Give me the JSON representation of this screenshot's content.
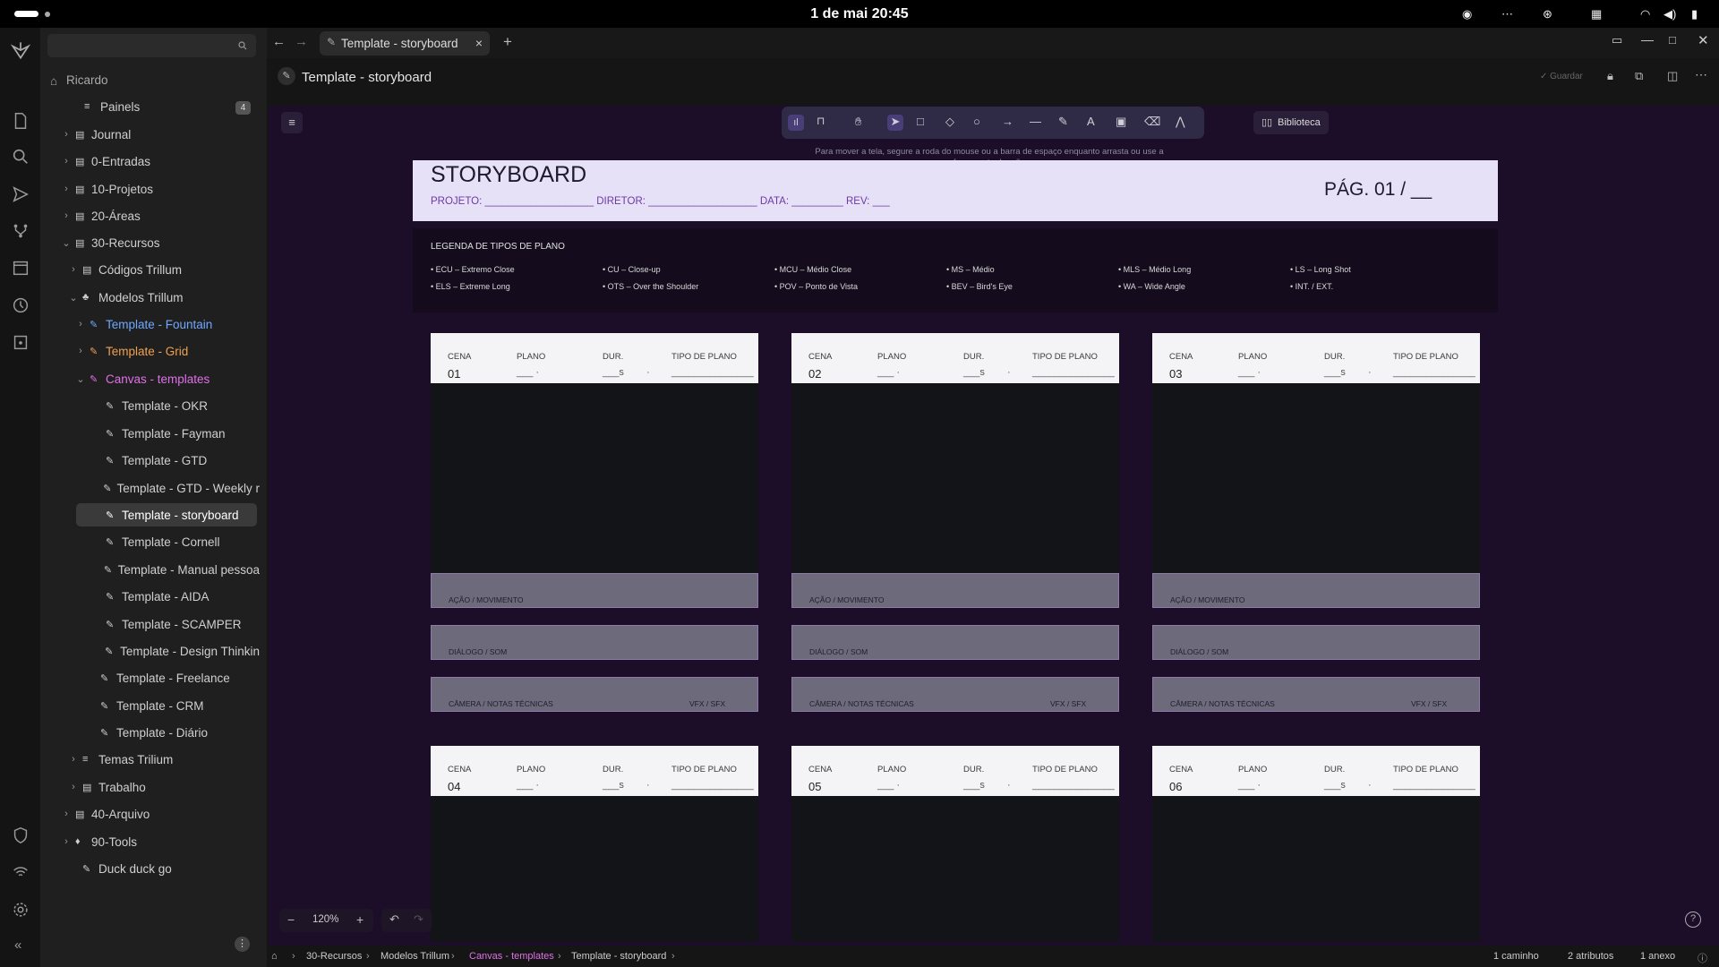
{
  "system": {
    "clock": "1 de mai  20:45"
  },
  "sidebar": {
    "user": "Ricardo",
    "badge": "4",
    "items": [
      {
        "label": "Painels",
        "color": "#cfcfcf"
      },
      {
        "label": "Journal",
        "color": "#cfcfcf"
      },
      {
        "label": "0-Entradas",
        "color": "#cfcfcf"
      },
      {
        "label": "10-Projetos",
        "color": "#cfcfcf"
      },
      {
        "label": "20-Áreas",
        "color": "#cfcfcf"
      },
      {
        "label": "30-Recursos",
        "color": "#cfcfcf"
      },
      {
        "label": "Códigos Trillum",
        "color": "#cfcfcf"
      },
      {
        "label": "Modelos Trillum",
        "color": "#cfcfcf"
      },
      {
        "label": "Template - Fountain",
        "color": "#6ea8ff"
      },
      {
        "label": "Template - Grid",
        "color": "#f0a050"
      },
      {
        "label": "Canvas - templates",
        "color": "#e070e8"
      },
      {
        "label": "Template - OKR",
        "color": "#cfcfcf"
      },
      {
        "label": "Template - Fayman",
        "color": "#cfcfcf"
      },
      {
        "label": "Template - GTD",
        "color": "#cfcfcf"
      },
      {
        "label": "Template - GTD - Weekly r",
        "color": "#cfcfcf"
      },
      {
        "label": "Template - storyboard",
        "color": "#ffffff"
      },
      {
        "label": "Template - Cornell",
        "color": "#cfcfcf"
      },
      {
        "label": "Template - Manual pessoa",
        "color": "#cfcfcf"
      },
      {
        "label": "Template - AIDA",
        "color": "#cfcfcf"
      },
      {
        "label": "Template - SCAMPER",
        "color": "#cfcfcf"
      },
      {
        "label": "Template - Design Thinkin",
        "color": "#cfcfcf"
      },
      {
        "label": "Template - Freelance",
        "color": "#cfcfcf"
      },
      {
        "label": "Template - CRM",
        "color": "#cfcfcf"
      },
      {
        "label": "Template - Diário",
        "color": "#cfcfcf"
      },
      {
        "label": "Temas Trilium",
        "color": "#cfcfcf"
      },
      {
        "label": "Trabalho",
        "color": "#cfcfcf"
      },
      {
        "label": "40-Arquivo",
        "color": "#cfcfcf"
      },
      {
        "label": "90-Tools",
        "color": "#cfcfcf"
      },
      {
        "label": "Duck duck go",
        "color": "#cfcfcf"
      }
    ]
  },
  "tab": {
    "title": "Template - storyboard",
    "close": "×",
    "new": "+"
  },
  "note": {
    "title": "Template - storyboard",
    "save": "✓ Guardar"
  },
  "canvas": {
    "library": "Biblioteca",
    "hint": "Para mover a tela, segure a roda do mouse ou a barra de espaço enquanto arrasta ou use a ferramenta de mão",
    "zoom": "120%"
  },
  "storyboard": {
    "title": "STORYBOARD",
    "project_row": "PROJETO: ___________________   DIRETOR: ___________________   DATA: _________   REV: ___",
    "page": "PÁG. 01 / __",
    "legend_title": "LEGENDA DE TIPOS DE PLANO",
    "legend": [
      "• ECU – Extremo Close",
      "• CU – Close-up",
      "• MCU – Médio Close",
      "• MS – Médio",
      "• MLS – Médio Long",
      "• LS – Long Shot",
      "• ELS – Extreme Long",
      "• OTS – Over the Shoulder",
      "• POV – Ponto de Vista",
      "• BEV – Bird's Eye",
      "• WA – Wide Angle",
      "• INT. / EXT."
    ],
    "labels": {
      "cena": "CENA",
      "plano": "PLANO",
      "dur": "DUR.",
      "tipo": "TIPO DE PLANO",
      "plano_blank": "___ ·",
      "dur_blank": "___s",
      "dot": "·",
      "tipo_blank": "_______________",
      "acao": "AÇÃO / MOVIMENTO",
      "dialogo": "DIÁLOGO / SOM",
      "camera": "CÂMERA / NOTAS TÉCNICAS",
      "vfx": "VFX / SFX"
    },
    "scenes": [
      "01",
      "02",
      "03",
      "04",
      "05",
      "06"
    ]
  },
  "status": {
    "crumbs": [
      "30-Recursos",
      "Modelos Trillum",
      "Canvas - templates",
      "Template - storyboard"
    ],
    "paths": "1 caminho",
    "attrs": "2 atributos",
    "attach": "1 anexo"
  }
}
